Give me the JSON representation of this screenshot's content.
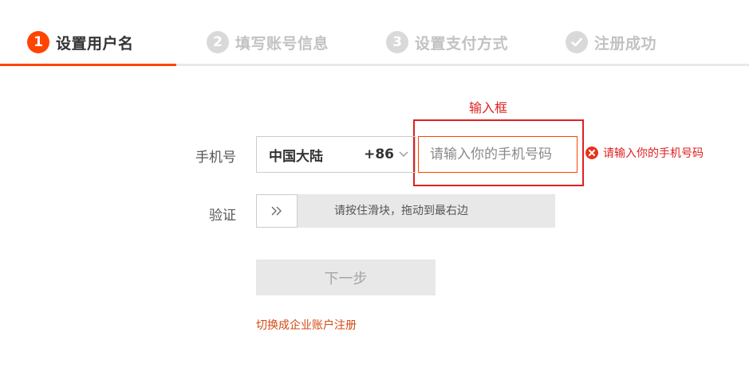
{
  "steps": [
    {
      "number": "1",
      "label": "设置用户名",
      "state": "active"
    },
    {
      "number": "2",
      "label": "填写账号信息",
      "state": "pending"
    },
    {
      "number": "3",
      "label": "设置支付方式",
      "state": "pending"
    },
    {
      "number": "",
      "label": "注册成功",
      "state": "pending",
      "icon": "check-icon"
    }
  ],
  "annotation": {
    "label": "输入框"
  },
  "form": {
    "phone_label": "手机号",
    "country": {
      "name": "中国大陆",
      "code": "+86"
    },
    "phone_input": {
      "value": "",
      "placeholder": "请输入你的手机号码"
    },
    "error": {
      "icon": "error-x-icon",
      "text": "请输入你的手机号码"
    },
    "verify_label": "验证",
    "slider": {
      "handle_icon": "double-chevron-right-icon",
      "text": "请按住滑块，拖动到最右边"
    },
    "next_button": "下一步",
    "switch_link": "切换成企业账户注册"
  },
  "colors": {
    "accent": "#ff4400",
    "error": "#e02020",
    "inactive": "#c2c2c2"
  }
}
